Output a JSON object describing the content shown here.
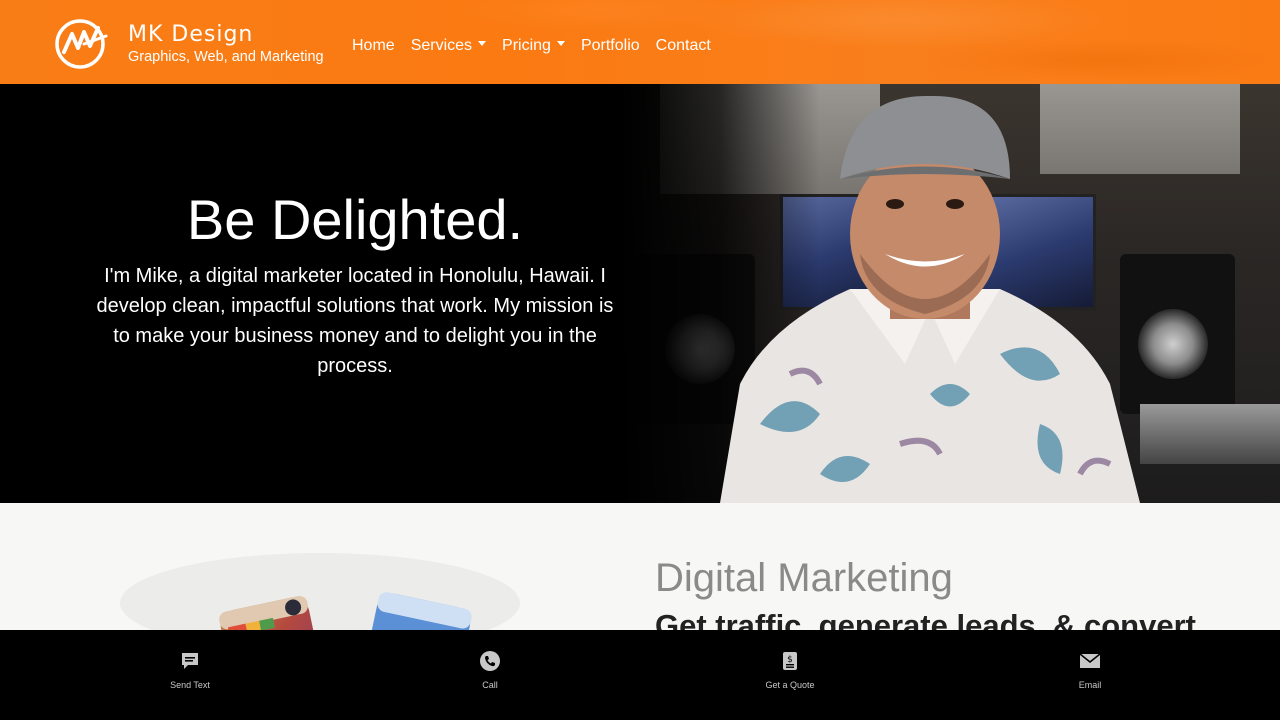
{
  "brand": {
    "title": "MK Design",
    "subtitle": "Graphics, Web, and Marketing",
    "accent": "#fb7a12"
  },
  "nav": {
    "items": [
      {
        "label": "Home",
        "dropdown": false
      },
      {
        "label": "Services",
        "dropdown": true
      },
      {
        "label": "Pricing",
        "dropdown": true
      },
      {
        "label": "Portfolio",
        "dropdown": false
      },
      {
        "label": "Contact",
        "dropdown": false
      }
    ]
  },
  "hero": {
    "title": "Be Delighted.",
    "text": "I'm Mike, a digital marketer located in Honolulu, Hawaii. I develop clean, impactful solutions that work. My mission is to make your business money and to delight you in the process."
  },
  "section": {
    "title": "Digital Marketing",
    "subtitle": "Get traffic, generate leads, & convert"
  },
  "bottom_bar": {
    "items": [
      {
        "label": "Send Text",
        "icon": "chat-icon"
      },
      {
        "label": "Call",
        "icon": "phone-icon"
      },
      {
        "label": "Get a Quote",
        "icon": "quote-icon"
      },
      {
        "label": "Email",
        "icon": "email-icon"
      }
    ]
  }
}
